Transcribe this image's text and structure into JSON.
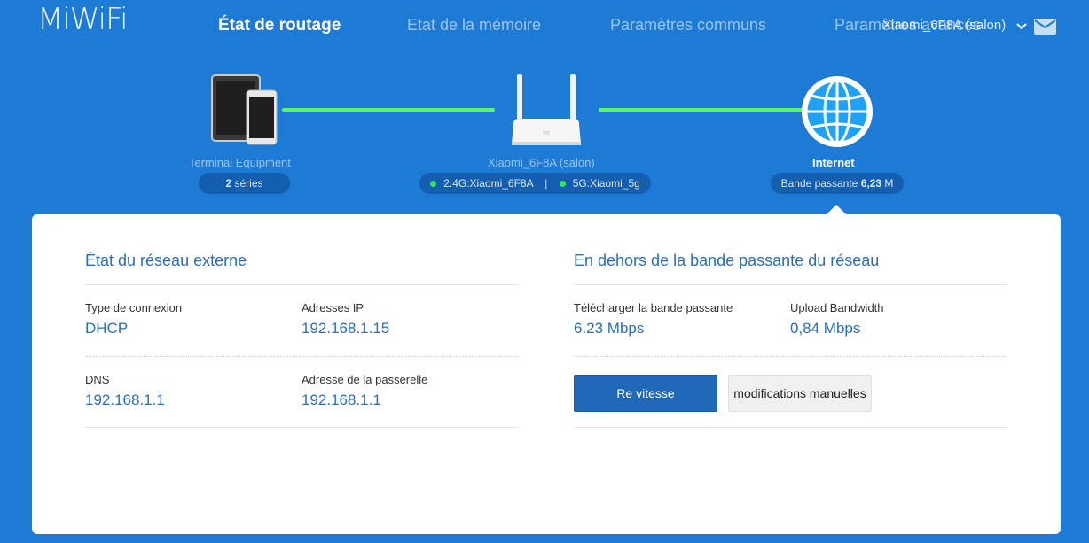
{
  "header": {
    "logo_text": "MiWiFi",
    "nav": [
      {
        "label": "État de routage",
        "active": true
      },
      {
        "label": "Etat de la mémoire",
        "active": false
      },
      {
        "label": "Paramètres communs",
        "active": false
      },
      {
        "label": "Paramètres avancés",
        "active": false
      }
    ],
    "router_name": "Xiaomi_6F8A (salon)"
  },
  "topology": {
    "terminal": {
      "label": "Terminal Equipment",
      "count": "2",
      "count_suffix": "séries"
    },
    "router": {
      "label": "Xiaomi_6F8A (salon)",
      "wifi_24": "2.4G:Xiaomi_6F8A",
      "wifi_5": "5G:Xiaomi_5g",
      "wifi_sep": "|"
    },
    "internet": {
      "label": "Internet",
      "bandwidth_label": "Bande passante",
      "bandwidth_value": "6,23",
      "bandwidth_unit": "M"
    }
  },
  "external_network": {
    "title": "État du réseau externe",
    "connection_type_label": "Type de connexion",
    "connection_type_value": "DHCP",
    "ip_label": "Adresses IP",
    "ip_value": "192.168.1.15",
    "dns_label": "DNS",
    "dns_value": "192.168.1.1",
    "gateway_label": "Adresse de la passerelle",
    "gateway_value": "192.168.1.1"
  },
  "bandwidth": {
    "title": "En dehors de la bande passante du réseau",
    "download_label": "Télécharger la bande passante",
    "download_value": "6.23 Mbps",
    "upload_label": "Upload Bandwidth",
    "upload_value": "0,84 Mbps",
    "speedtest_button": "Re vitesse",
    "manual_button": "modifications manuelles"
  },
  "colors": {
    "background": "#1d7bd6",
    "accent": "#2a6fb6",
    "link_green": "#5df56a",
    "status_dot": "#3ee05a"
  }
}
